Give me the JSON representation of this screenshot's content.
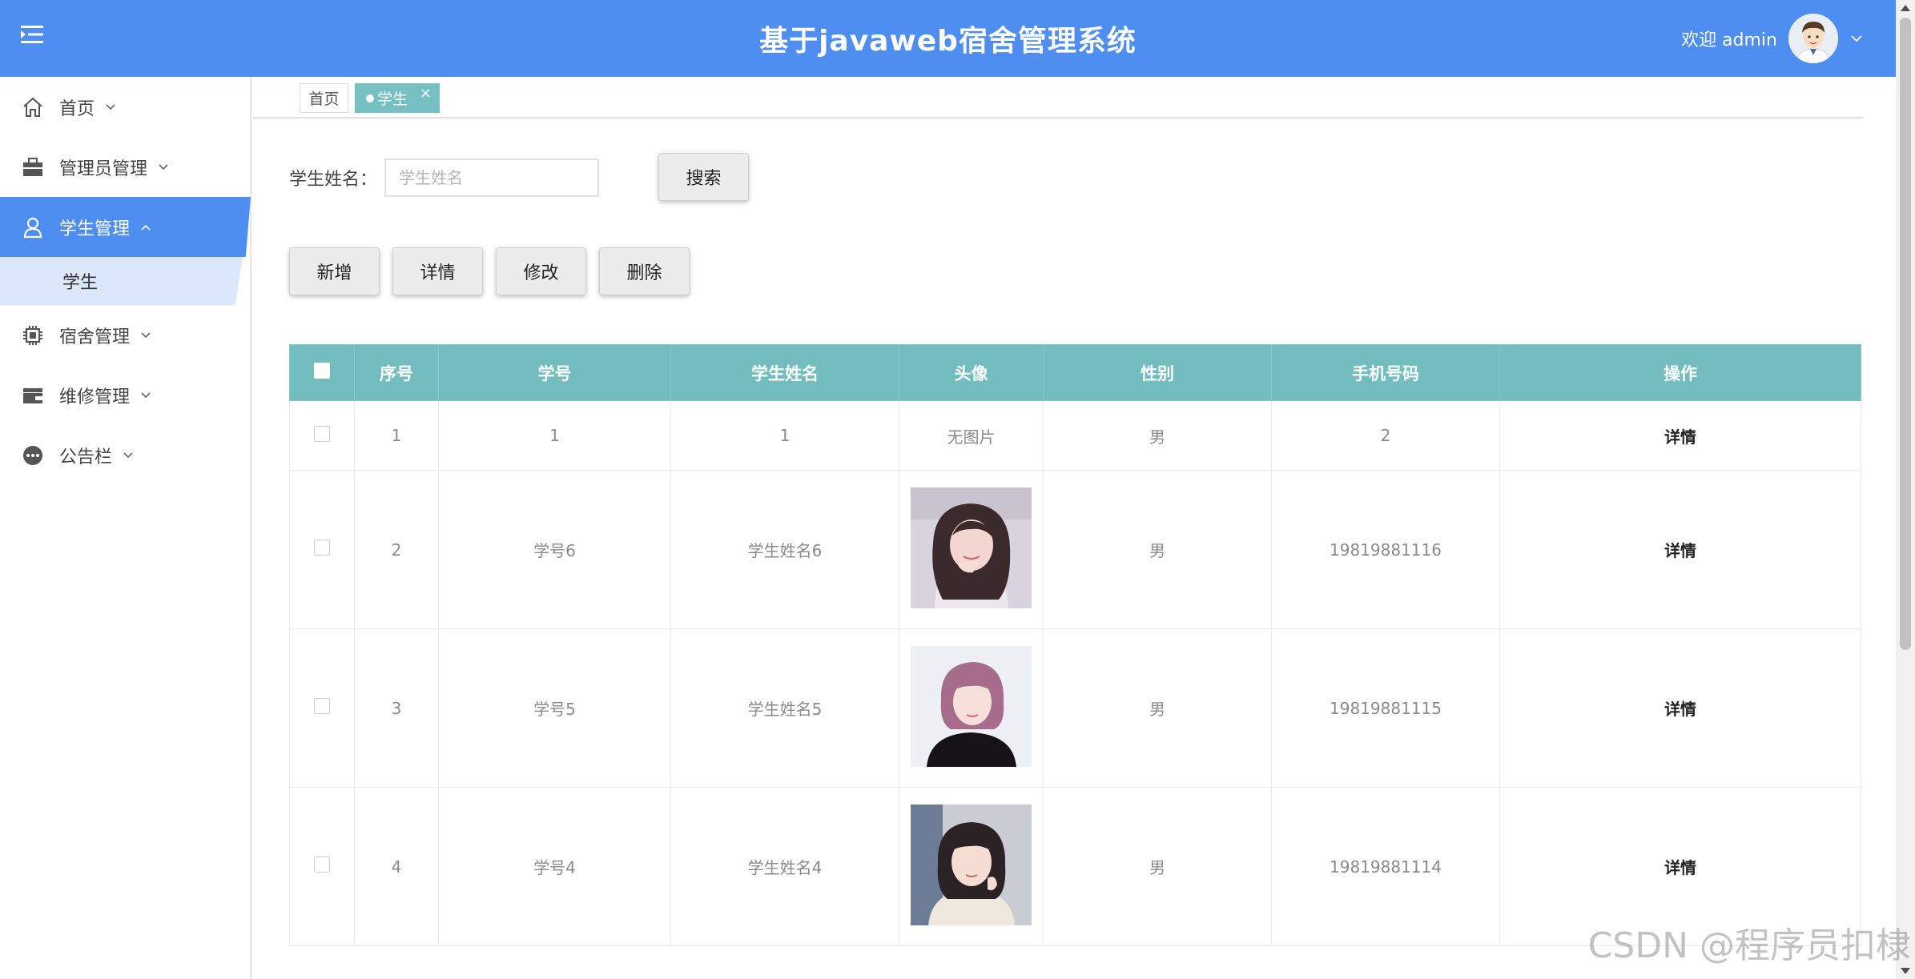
{
  "header": {
    "title": "基于javaweb宿舍管理系统",
    "welcome": "欢迎 admin",
    "bg_color": "#4e8ef0"
  },
  "sidebar": {
    "items": [
      {
        "label": "首页",
        "icon": "home-icon"
      },
      {
        "label": "管理员管理",
        "icon": "briefcase-icon"
      },
      {
        "label": "学生管理",
        "icon": "person-icon",
        "active": true
      },
      {
        "label": "宿舍管理",
        "icon": "chip-icon"
      },
      {
        "label": "维修管理",
        "icon": "wallet-icon"
      },
      {
        "label": "公告栏",
        "icon": "dots-circle-icon"
      }
    ],
    "subitem": "学生"
  },
  "tabs": [
    {
      "label": "首页"
    },
    {
      "label": "学生",
      "active": true
    }
  ],
  "search": {
    "label": "学生姓名：",
    "placeholder": "学生姓名",
    "button": "搜索"
  },
  "actions": {
    "add": "新增",
    "detail": "详情",
    "edit": "修改",
    "delete": "删除"
  },
  "table": {
    "header_color": "#74bdbf",
    "columns": [
      "序号",
      "学号",
      "学生姓名",
      "头像",
      "性别",
      "手机号码",
      "操作"
    ],
    "rows": [
      {
        "no": "1",
        "student_id": "1",
        "name": "1",
        "avatar_text": "无图片",
        "gender": "男",
        "phone": "2",
        "op": "详情"
      },
      {
        "no": "2",
        "student_id": "学号6",
        "name": "学生姓名6",
        "avatar_text": "",
        "gender": "男",
        "phone": "19819881116",
        "op": "详情"
      },
      {
        "no": "3",
        "student_id": "学号5",
        "name": "学生姓名5",
        "avatar_text": "",
        "gender": "男",
        "phone": "19819881115",
        "op": "详情"
      },
      {
        "no": "4",
        "student_id": "学号4",
        "name": "学生姓名4",
        "avatar_text": "",
        "gender": "男",
        "phone": "19819881114",
        "op": "详情"
      }
    ]
  },
  "watermark": "CSDN @程序员扣棣"
}
